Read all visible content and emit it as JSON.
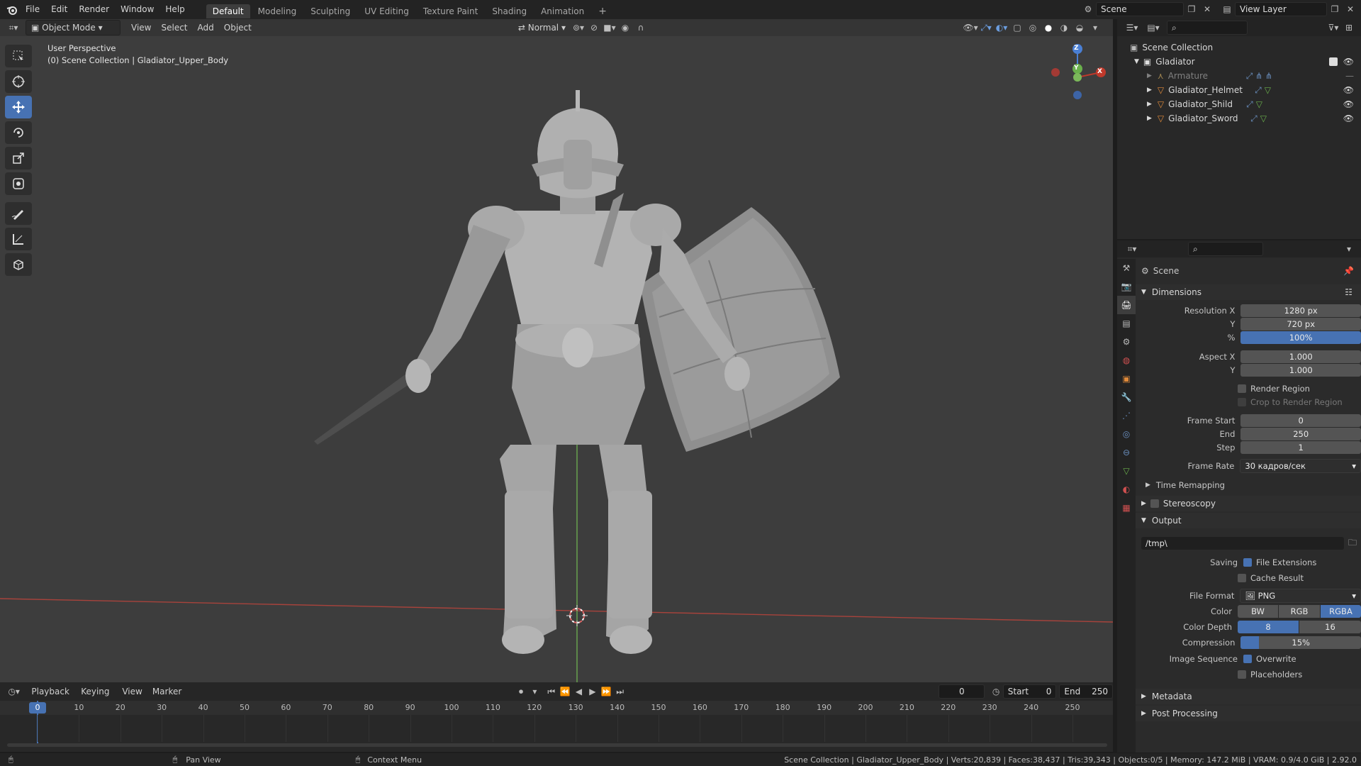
{
  "topbar": {
    "menus": [
      "File",
      "Edit",
      "Render",
      "Window",
      "Help"
    ],
    "workspaces": [
      "Default",
      "Modeling",
      "Sculpting",
      "UV Editing",
      "Texture Paint",
      "Shading",
      "Animation"
    ],
    "active_workspace": "Default",
    "scene_name": "Scene",
    "view_layer": "View Layer"
  },
  "viewport": {
    "mode": "Object Mode",
    "menus": [
      "View",
      "Select",
      "Add",
      "Object"
    ],
    "orientation": "Normal",
    "perspective": "User Perspective",
    "collection_info": "(0) Scene Collection | Gladiator_Upper_Body",
    "gizmo_axes": {
      "x": "X",
      "y": "Y",
      "z": "Z"
    },
    "colors": {
      "bg": "#3d3d3d",
      "x_axis": "#c0392b",
      "y_axis": "#6ab04c",
      "z_axis": "#4a7fd4",
      "model": "#a8a8a8"
    }
  },
  "tools": [
    "select-box-icon",
    "cursor-icon",
    "move-icon",
    "rotate-icon",
    "scale-icon",
    "transform-icon",
    "annotate-icon",
    "measure-icon",
    "add-cube-icon"
  ],
  "outliner": {
    "root": "Scene Collection",
    "collection": "Gladiator",
    "items": [
      {
        "name": "Armature",
        "dim": true
      },
      {
        "name": "Gladiator_Helmet",
        "dim": false
      },
      {
        "name": "Gladiator_Shild",
        "dim": false
      },
      {
        "name": "Gladiator_Sword",
        "dim": false
      }
    ]
  },
  "properties": {
    "context": "Scene",
    "dimensions": {
      "title": "Dimensions",
      "resolution_x_label": "Resolution X",
      "resolution_x": "1280 px",
      "y_label": "Y",
      "resolution_y": "720 px",
      "percent_label": "%",
      "percent": "100%",
      "aspect_x_label": "Aspect X",
      "aspect_x": "1.000",
      "aspect_y": "1.000",
      "render_region": "Render Region",
      "crop": "Crop to Render Region",
      "frame_start_label": "Frame Start",
      "frame_start": "0",
      "end_label": "End",
      "frame_end": "250",
      "step_label": "Step",
      "step": "1",
      "frame_rate_label": "Frame Rate",
      "frame_rate": "30 кадров/сек",
      "time_remapping": "Time Remapping"
    },
    "stereoscopy": "Stereoscopy",
    "output": {
      "title": "Output",
      "path": "/tmp\\",
      "saving_label": "Saving",
      "file_extensions": "File Extensions",
      "cache_result": "Cache Result",
      "file_format_label": "File Format",
      "file_format": "PNG",
      "color_label": "Color",
      "color_options": [
        "BW",
        "RGB",
        "RGBA"
      ],
      "color_selected": "RGBA",
      "color_depth_label": "Color Depth",
      "depth_options": [
        "8",
        "16"
      ],
      "depth_selected": "8",
      "compression_label": "Compression",
      "compression": "15%",
      "compression_fraction": 0.15,
      "image_sequence_label": "Image Sequence",
      "overwrite": "Overwrite",
      "placeholders": "Placeholders"
    },
    "metadata": "Metadata",
    "post_processing": "Post Processing"
  },
  "timeline": {
    "menus": [
      "Playback",
      "Keying",
      "View",
      "Marker"
    ],
    "current_frame": "0",
    "start_label": "Start",
    "start": "0",
    "end_label": "End",
    "end": "250",
    "ticks": [
      "0",
      "10",
      "20",
      "30",
      "40",
      "50",
      "60",
      "70",
      "80",
      "90",
      "100",
      "110",
      "120",
      "130",
      "140",
      "150",
      "160",
      "170",
      "180",
      "190",
      "200",
      "210",
      "220",
      "230",
      "240",
      "250"
    ]
  },
  "statusbar": {
    "pan": "Pan View",
    "context_menu": "Context Menu",
    "stats": "Scene Collection | Gladiator_Upper_Body | Verts:20,839 | Faces:38,437 | Tris:39,343 | Objects:0/5 | Memory: 147.2 MiB | VRAM: 0.9/4.0 GiB | 2.92.0"
  }
}
